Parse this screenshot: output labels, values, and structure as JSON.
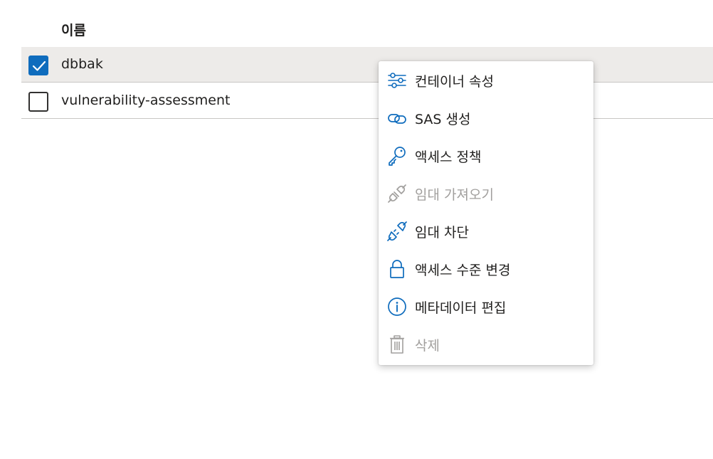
{
  "table": {
    "column_name": "이름",
    "rows": [
      {
        "name": "dbbak",
        "checked": true
      },
      {
        "name": "vulnerability-assessment",
        "checked": false
      }
    ]
  },
  "context_menu": {
    "items": [
      {
        "label": "컨테이너 속성",
        "icon": "sliders-icon",
        "enabled": true
      },
      {
        "label": "SAS 생성",
        "icon": "link-icon",
        "enabled": true
      },
      {
        "label": "액세스 정책",
        "icon": "key-icon",
        "enabled": true
      },
      {
        "label": "임대 가져오기",
        "icon": "plug-connect-icon",
        "enabled": false
      },
      {
        "label": "임대 차단",
        "icon": "plug-disconnect-icon",
        "enabled": true
      },
      {
        "label": "액세스 수준 변경",
        "icon": "lock-icon",
        "enabled": true
      },
      {
        "label": "메타데이터 편집",
        "icon": "info-icon",
        "enabled": true
      },
      {
        "label": "삭제",
        "icon": "trash-icon",
        "enabled": false
      }
    ]
  },
  "colors": {
    "accent": "#0f6cbd",
    "selected_row": "#edebe9",
    "disabled_text": "#a19f9d"
  }
}
